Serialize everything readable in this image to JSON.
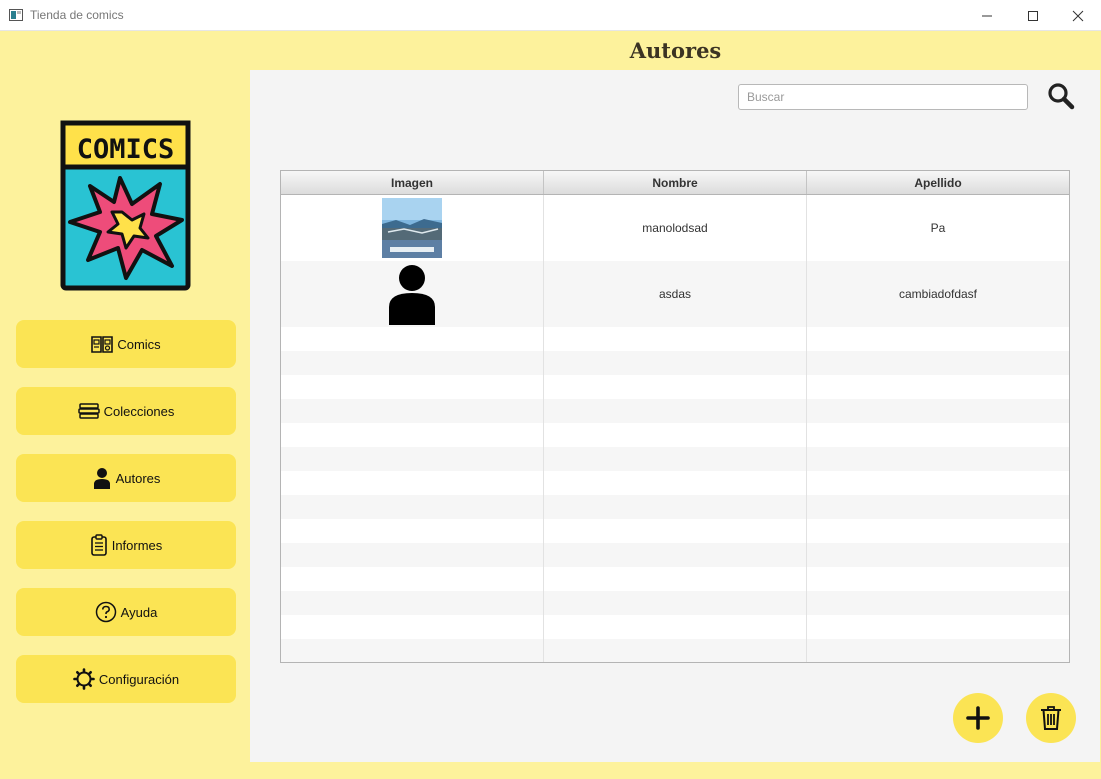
{
  "window": {
    "title": "Tienda de comics",
    "controls": [
      "minimize-icon",
      "maximize-icon",
      "close-icon"
    ]
  },
  "logo": {
    "text": "COMICS"
  },
  "sidebar": {
    "items": [
      {
        "label": "Comics",
        "icon": "comic-book-icon"
      },
      {
        "label": "Colecciones",
        "icon": "stack-icon"
      },
      {
        "label": "Autores",
        "icon": "person-icon"
      },
      {
        "label": "Informes",
        "icon": "clipboard-icon"
      },
      {
        "label": "Ayuda",
        "icon": "help-icon"
      },
      {
        "label": "Configuración",
        "icon": "gear-icon"
      }
    ]
  },
  "header": {
    "title": "Autores"
  },
  "search": {
    "placeholder": "Buscar",
    "value": "",
    "icon": "search-icon"
  },
  "table": {
    "columns": [
      "Imagen",
      "Nombre",
      "Apellido"
    ],
    "rows": [
      {
        "image": "cover-thumbnail",
        "nombre": "manolodsad",
        "apellido": "Pa"
      },
      {
        "image": "person-placeholder-icon",
        "nombre": "asdas",
        "apellido": "cambiadofdasf"
      }
    ]
  },
  "actions": {
    "add_icon": "plus-icon",
    "delete_icon": "trash-icon"
  },
  "colors": {
    "background": "#fdf29c",
    "button": "#fbe454",
    "content": "#f4f4f4",
    "logo_cyan": "#29c3d3",
    "logo_pink": "#ee4c7a",
    "logo_yellow": "#ffe14a"
  }
}
